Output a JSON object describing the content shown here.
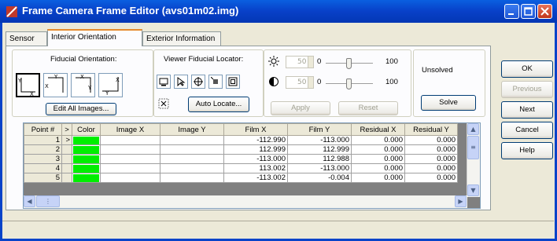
{
  "window": {
    "title": "Frame Camera Frame Editor (avs01m02.img)",
    "accent": "#0840c8"
  },
  "tabs": [
    {
      "label": "Sensor"
    },
    {
      "label": "Interior Orientation"
    },
    {
      "label": "Exterior Information"
    }
  ],
  "fiducial_orientation": {
    "label": "Fiducial Orientation:",
    "edit_all_label": "Edit All Images..."
  },
  "viewer_locator": {
    "label": "Viewer Fiducial Locator:",
    "auto_locate_label": "Auto Locate..."
  },
  "adjust": {
    "brightness": {
      "value": "50",
      "min": "0",
      "max": "100",
      "level": 0.5
    },
    "contrast": {
      "value": "50",
      "min": "0",
      "max": "100",
      "level": 0.5
    },
    "apply_label": "Apply",
    "reset_label": "Reset"
  },
  "solve": {
    "status": "Unsolved",
    "solve_label": "Solve"
  },
  "side_buttons": {
    "ok": "OK",
    "previous": "Previous",
    "next": "Next",
    "cancel": "Cancel",
    "help": "Help"
  },
  "grid": {
    "columns": [
      "Point #",
      ">",
      "Color",
      "Image X",
      "Image Y",
      "Film X",
      "Film Y",
      "Residual X",
      "Residual Y"
    ],
    "rows": [
      {
        "point": "1",
        "marker": ">",
        "image_x": "",
        "image_y": "",
        "film_x": "-112.990",
        "film_y": "-113.000",
        "res_x": "0.000",
        "res_y": "0.000"
      },
      {
        "point": "2",
        "marker": "",
        "image_x": "",
        "image_y": "",
        "film_x": "112.999",
        "film_y": "112.999",
        "res_x": "0.000",
        "res_y": "0.000"
      },
      {
        "point": "3",
        "marker": "",
        "image_x": "",
        "image_y": "",
        "film_x": "-113.000",
        "film_y": "112.988",
        "res_x": "0.000",
        "res_y": "0.000"
      },
      {
        "point": "4",
        "marker": "",
        "image_x": "",
        "image_y": "",
        "film_x": "113.002",
        "film_y": "-113.000",
        "res_x": "0.000",
        "res_y": "0.000"
      },
      {
        "point": "5",
        "marker": "",
        "image_x": "",
        "image_y": "",
        "film_x": "-113.002",
        "film_y": "-0.004",
        "res_x": "0.000",
        "res_y": "0.000"
      }
    ],
    "point_color": "#00ee00"
  }
}
